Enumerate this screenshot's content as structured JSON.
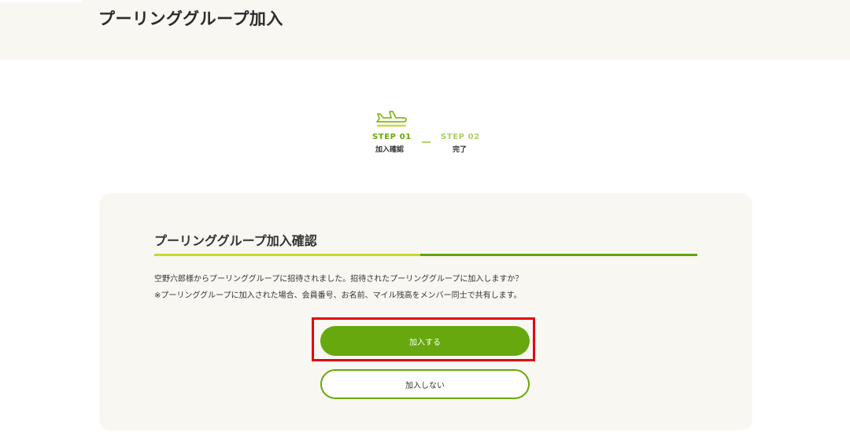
{
  "header": {
    "title": "プーリンググループ加入"
  },
  "stepper": {
    "steps": [
      {
        "number": "STEP 01",
        "label": "加入確認",
        "state": "current",
        "icon": "airplane-icon"
      },
      {
        "number": "STEP 02",
        "label": "完了",
        "state": "upcoming"
      }
    ]
  },
  "card": {
    "title": "プーリンググループ加入確認",
    "message_line1": "空野六郎様からプーリンググループに招待されました。招待されたプーリンググループに加入しますか？",
    "message_line2": "※プーリンググループに加入された場合、会員番号、お名前、マイル残高をメンバー同士で共有します。",
    "join_button_label": "加入する",
    "decline_button_label": "加入しない"
  },
  "colors": {
    "accent_green": "#66a80e",
    "light_green": "#c6d92a",
    "highlight_red": "#e60012",
    "panel_bg": "#f8f7f2"
  }
}
